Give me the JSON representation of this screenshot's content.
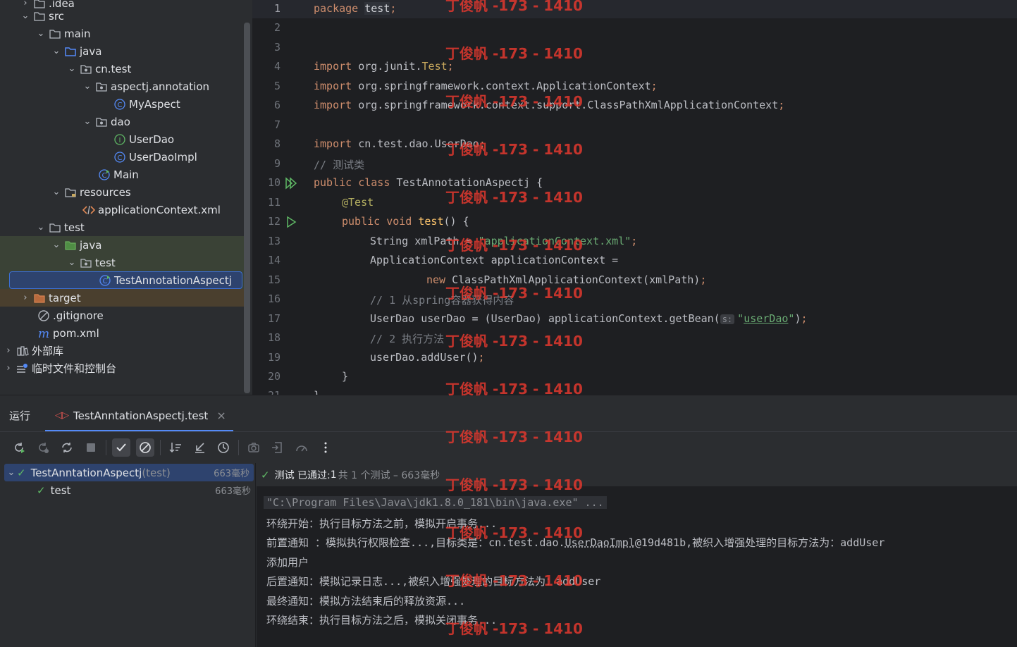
{
  "project_tree": {
    "items": [
      {
        "label": ".idea",
        "icon": "folder-icon"
      },
      {
        "label": "src",
        "icon": "folder-icon"
      },
      {
        "label": "main",
        "icon": "folder-icon"
      },
      {
        "label": "java",
        "icon": "source-folder-icon"
      },
      {
        "label": "cn.test",
        "icon": "package-icon"
      },
      {
        "label": "aspectj.annotation",
        "icon": "package-icon"
      },
      {
        "label": "MyAspect",
        "icon": "class-icon"
      },
      {
        "label": "dao",
        "icon": "package-icon"
      },
      {
        "label": "UserDao",
        "icon": "interface-icon"
      },
      {
        "label": "UserDaoImpl",
        "icon": "class-icon"
      },
      {
        "label": "Main",
        "icon": "runnable-class-icon"
      },
      {
        "label": "resources",
        "icon": "resources-folder-icon"
      },
      {
        "label": "applicationContext.xml",
        "icon": "xml-file-icon"
      },
      {
        "label": "test",
        "icon": "folder-icon"
      },
      {
        "label": "java",
        "icon": "test-source-folder-icon"
      },
      {
        "label": "test",
        "icon": "package-icon"
      },
      {
        "label": "TestAnnotationAspectj",
        "icon": "runnable-class-icon"
      },
      {
        "label": "target",
        "icon": "excluded-folder-icon"
      },
      {
        "label": ".gitignore",
        "icon": "ignore-file-icon"
      },
      {
        "label": "pom.xml",
        "icon": "maven-icon"
      },
      {
        "label": "外部库",
        "icon": "library-icon"
      },
      {
        "label": "临时文件和控制台",
        "icon": "scratch-icon"
      }
    ]
  },
  "editor": {
    "line_numbers": [
      "1",
      "2",
      "3",
      "4",
      "5",
      "6",
      "7",
      "8",
      "9",
      "10",
      "11",
      "12",
      "13",
      "14",
      "15",
      "16",
      "17",
      "18",
      "19",
      "20",
      "21"
    ],
    "l1_kw": "package",
    "l1_pkg": "test",
    "l1_semi": ";",
    "l4_kw": "import",
    "l4_a": " org.junit.",
    "l4_b": "Test",
    "l4_c": ";",
    "l5_kw": "import",
    "l5_a": " org.springframework.context.ApplicationContext",
    "l5_c": ";",
    "l6_kw": "import",
    "l6_a": " org.springframework.context.support.ClassPathXmlApplicationContext",
    "l6_c": ";",
    "l8_kw": "import",
    "l8_a": " cn.test.dao.UserDao",
    "l8_c": ";",
    "l9_cmt": "// 测试类",
    "l10_kw": "public class",
    "l10_a": " TestAnnotationAspectj {",
    "l11_ann": "@Test",
    "l12_kw": "public void",
    "l12_fn": "test",
    "l12_a": "() {",
    "l13_a": "String xmlPath = ",
    "l13_str": "\"applicationContext.xml\"",
    "l13_c": ";",
    "l14_a": "ApplicationContext applicationContext =",
    "l15_kw": "new",
    "l15_a": " ClassPathXmlApplicationContext(xmlPath)",
    "l15_c": ";",
    "l16_cmt": "// 1 从spring容器获得内容",
    "l17_a": "UserDao userDao = (UserDao) applicationContext.getBean(",
    "l17_hint": "s:",
    "l17_q1": "\"",
    "l17_str": "userDao",
    "l17_q2": "\"",
    "l17_b": ")",
    "l17_c": ";",
    "l18_cmt": "// 2 执行方法",
    "l19_a": "userDao.addUser()",
    "l19_c": ";",
    "l20_a": "}",
    "l21_a": "}"
  },
  "watermark": "丁俊帆 -173 - 1410",
  "run_window": {
    "title": "运行",
    "tab_label": "TestAnntationAspectj.test",
    "test_tree": {
      "root_label": "TestAnntationAspectj",
      "root_suffix": " (test)",
      "root_time": "663毫秒",
      "child_label": "test",
      "child_time": "663毫秒"
    },
    "status": {
      "label": "测试 已通过: ",
      "count": "1",
      "detail": "共 1 个测试 – 663毫秒"
    },
    "console": {
      "cmd": "\"C:\\Program Files\\Java\\jdk1.8.0_181\\bin\\java.exe\" ...",
      "l2": "环绕开始：执行目标方法之前，模拟开启事务...",
      "l3_a": "前置通知 ：模拟执行权限检查...,目标类是：cn.test.dao.",
      "l3_link": "UserDaoImpl",
      "l3_b": "@19d481b,被织入增强处理的目标方法为：addUser",
      "l4": "添加用户",
      "l5": "后置通知：模拟记录日志...,被织入增强处理的目标方法为：addUser",
      "l6": "最终通知：模拟方法结束后的释放资源...",
      "l7": "环绕结束：执行目标方法之后，模拟关闭事务..."
    }
  },
  "colors": {
    "keyword": "#cf8e6d",
    "string": "#6aab73",
    "comment": "#7a7e85",
    "annotation": "#b3ae60",
    "pass_green": "#5fb865",
    "selection": "#2e436e",
    "watermark": "#e2382e"
  }
}
